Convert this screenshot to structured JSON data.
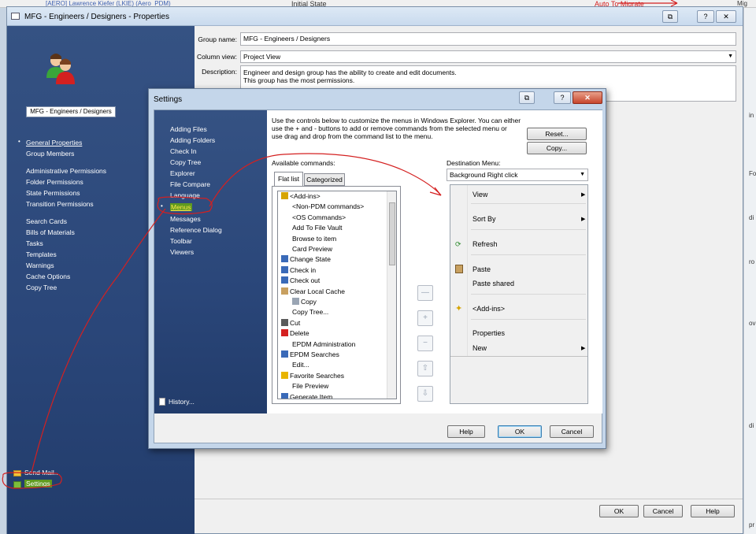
{
  "background": {
    "top_user": "[AERO] Lawrence Kiefer (LKIE) (Aero_PDM)",
    "top_state": "Initial State",
    "top_transition": "Auto To Migrate",
    "top_right_text": "Mig",
    "right_fragments": [
      "in",
      "Fo",
      "di",
      "ro",
      "ov",
      "di",
      "pr"
    ]
  },
  "main_window": {
    "title": "MFG - Engineers / Designers - Properties",
    "help_btn": "?",
    "close_btn": "✕",
    "restore_btn": "⧉"
  },
  "sidebar": {
    "group_name": "MFG - Engineers / Designers",
    "items": [
      {
        "label": "General Properties"
      },
      {
        "label": "Group Members"
      },
      {
        "label": "Administrative Permissions"
      },
      {
        "label": "Folder Permissions"
      },
      {
        "label": "State Permissions"
      },
      {
        "label": "Transition Permissions"
      },
      {
        "label": "Search Cards"
      },
      {
        "label": "Bills of Materials"
      },
      {
        "label": "Tasks"
      },
      {
        "label": "Templates"
      },
      {
        "label": "Warnings"
      },
      {
        "label": "Cache Options"
      },
      {
        "label": "Copy Tree"
      }
    ],
    "send_mail": "Send Mail...",
    "settings": "Settings"
  },
  "form": {
    "group_name_label": "Group name:",
    "group_name_value": "MFG - Engineers / Designers",
    "column_view_label": "Column view:",
    "column_view_value": "Project View",
    "description_label": "Description:",
    "description_line1": "Engineer and design group has the ability to create and edit documents.",
    "description_line2": "This group has the most permissions."
  },
  "footer": {
    "ok": "OK",
    "cancel": "Cancel",
    "help": "Help"
  },
  "settings_dialog": {
    "title": "Settings",
    "nav": [
      {
        "label": "Adding Files"
      },
      {
        "label": "Adding Folders"
      },
      {
        "label": "Check In"
      },
      {
        "label": "Copy Tree"
      },
      {
        "label": "Explorer"
      },
      {
        "label": "File Compare"
      },
      {
        "label": "Language"
      },
      {
        "label": "Menus"
      },
      {
        "label": "Messages"
      },
      {
        "label": "Reference Dialog"
      },
      {
        "label": "Toolbar"
      },
      {
        "label": "Viewers"
      }
    ],
    "history": "History...",
    "instructions_1": "Use the controls below to customize the menus in Windows Explorer. You can either",
    "instructions_2": "use the + and - buttons to add or remove commands from the selected menu or",
    "instructions_3": "use drag and drop from the command list to the menu.",
    "reset": "Reset...",
    "copy": "Copy...",
    "available_commands": "Available commands:",
    "tab_flat": "Flat list",
    "tab_categorized": "Categorized",
    "commands": [
      "<Add-ins>",
      "<Non-PDM commands>",
      "<OS Commands>",
      "Add To File Vault",
      "Browse to item",
      "Card Preview",
      "Change State",
      "Check in",
      "Check out",
      "Clear Local Cache",
      "Copy",
      "Copy Tree...",
      "Cut",
      "Delete",
      "EPDM Administration",
      "EPDM Searches",
      "Edit...",
      "Favorite Searches",
      "File Preview",
      "Generate Item"
    ],
    "destination_label": "Destination Menu:",
    "destination_value": "Background Right click",
    "menu_items": {
      "view": "View",
      "sort_by": "Sort By",
      "refresh": "Refresh",
      "paste": "Paste",
      "paste_shared": "Paste shared",
      "addins": "<Add-ins>",
      "properties": "Properties",
      "new": "New"
    },
    "help": "Help",
    "ok": "OK",
    "cancel": "Cancel"
  }
}
